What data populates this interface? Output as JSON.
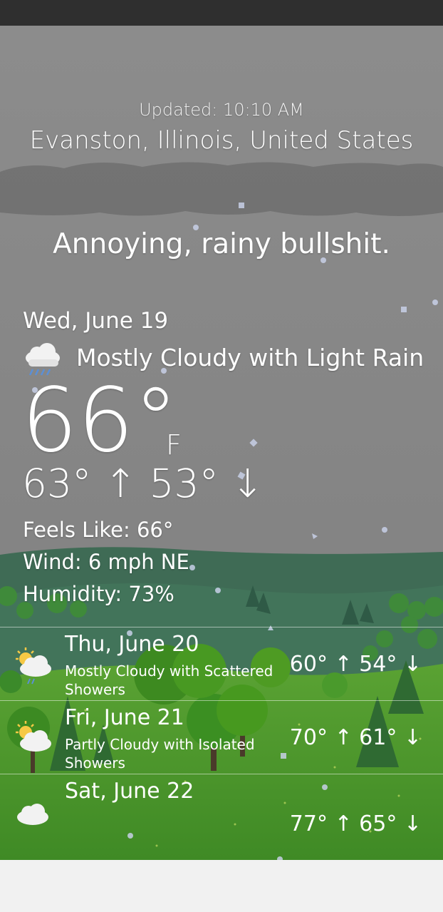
{
  "header": {
    "updated": "Updated: 10:10 AM",
    "location": "Evanston, Illinois, United States",
    "tagline": "Annoying, rainy bullshit."
  },
  "current": {
    "date": "Wed, June 19",
    "condition": "Mostly Cloudy with Light Rain",
    "condition_icon": "cloud-rain-icon",
    "temp": "66°",
    "unit": "F",
    "hi_lo": "63° ↑ 53° ↓",
    "feels_like": "Feels Like: 66°",
    "wind": "Wind: 6 mph NE",
    "humidity": "Humidity: 73%"
  },
  "forecast": [
    {
      "day": "Thu, June 20",
      "desc": "Mostly Cloudy with Scattered Showers",
      "hi_lo": "60° ↑ 54° ↓",
      "icon": "partly-cloudy-rain-icon"
    },
    {
      "day": "Fri, June 21",
      "desc": "Partly Cloudy with Isolated Showers",
      "hi_lo": "70° ↑ 61° ↓",
      "icon": "partly-cloudy-icon"
    },
    {
      "day": "Sat, June 22",
      "desc": "",
      "hi_lo": "77° ↑ 65° ↓",
      "icon": "cloud-icon"
    }
  ],
  "colors": {
    "sky": "#8a8a8a",
    "hill_dark": "#3f6b55",
    "grass": "#4f9a2c",
    "text": "#ffffff"
  }
}
